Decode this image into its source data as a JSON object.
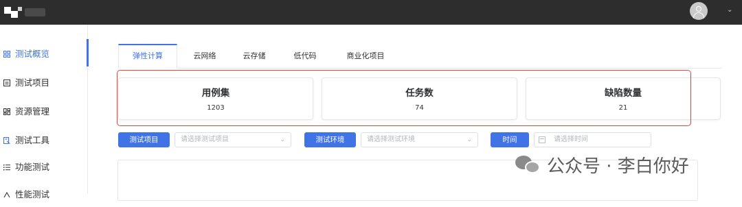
{
  "header": {
    "logo": "brand-logo",
    "user_menu_caret": "⌄"
  },
  "sidebar": {
    "items": [
      {
        "label": "测试概览",
        "icon": "grid-icon",
        "active": true
      },
      {
        "label": "测试项目",
        "icon": "list-box-icon"
      },
      {
        "label": "资源管理",
        "icon": "resource-grid-icon"
      },
      {
        "label": "测试工具",
        "icon": "tool-icon"
      },
      {
        "label": "功能测试",
        "icon": "bullet-list-icon"
      },
      {
        "label": "性能测试",
        "icon": "performance-icon"
      }
    ]
  },
  "main": {
    "tabs": [
      {
        "label": "弹性计算",
        "active": true
      },
      {
        "label": "云网络"
      },
      {
        "label": "云存储"
      },
      {
        "label": "低代码"
      },
      {
        "label": "商业化项目"
      }
    ],
    "stats": [
      {
        "title": "用例集",
        "value": "1203"
      },
      {
        "title": "任务数",
        "value": "74"
      },
      {
        "title": "缺陷数量",
        "value": "21"
      }
    ],
    "filters": {
      "project_button": "测试项目",
      "project_placeholder": "请选择测试项目",
      "env_button": "测试环境",
      "env_placeholder": "请选择测试环境",
      "time_button": "时间",
      "time_placeholder": "请选择时间"
    }
  },
  "watermark": {
    "text": "公众号 · 李白你好",
    "icon": "wechat-icon"
  },
  "colors": {
    "accent": "#3f73e6",
    "topbar": "#2d2d2d",
    "highlight_border": "#e0463a"
  }
}
